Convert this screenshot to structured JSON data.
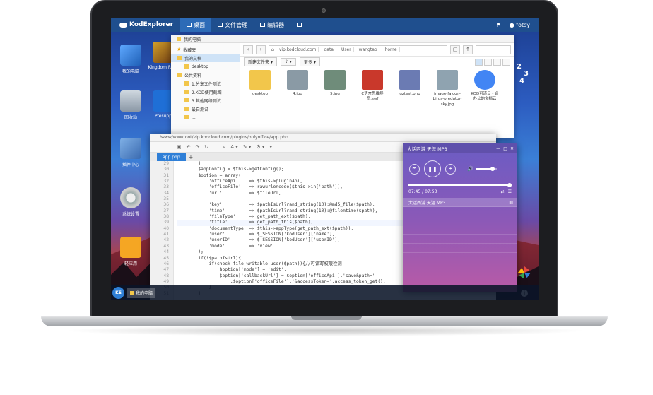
{
  "app": {
    "brand": "KodExplorer",
    "nav": [
      {
        "label": "桌面"
      },
      {
        "label": "文件管理"
      },
      {
        "label": "编辑器"
      }
    ],
    "user": "fotsy"
  },
  "desktop": {
    "icons": [
      {
        "label": "我的电脑"
      },
      {
        "label": "Kingdom Rush"
      },
      {
        "label": "回收站"
      },
      {
        "label": "Presupp"
      },
      {
        "label": "插件中心"
      },
      {
        "label": "系统设置"
      },
      {
        "label": "轻应用"
      }
    ],
    "clock_digits": [
      "2",
      "3",
      "4"
    ]
  },
  "taskbar": {
    "start_label": "KE",
    "items": [
      {
        "label": "我的电脑"
      }
    ]
  },
  "explorer": {
    "title": "我的电脑",
    "tree": [
      {
        "label": "收藏夹"
      },
      {
        "label": "我的文档"
      },
      {
        "label": "desktop"
      },
      {
        "label": "公共资料"
      },
      {
        "label": "1.分享文件测试"
      },
      {
        "label": "2.KOD使用截图"
      },
      {
        "label": "3.其他网络测试"
      },
      {
        "label": "最自测试"
      },
      {
        "label": "..."
      }
    ],
    "breadcrumbs": [
      "vip.kodcloud.com",
      "data",
      "User",
      "wangtao",
      "home"
    ],
    "new_folder": "新建文件夹",
    "more": "更多",
    "files": [
      {
        "name": "desktop",
        "color": "#f2c64b"
      },
      {
        "name": "4.jpg",
        "color": "#8a9aa5"
      },
      {
        "name": "5.jpg",
        "color": "#6f8c7a"
      },
      {
        "name": "C语言思维导图.swf",
        "color": "#c9382b"
      },
      {
        "name": "gztest.php",
        "color": "#6b7bb3"
      },
      {
        "name": "image-falcon-birds-predator-sky.jpg",
        "color": "#8fa3b0"
      },
      {
        "name": "KOD可道云 - 合办公的文档云",
        "color": "#4285f4"
      }
    ]
  },
  "editor": {
    "path": "/www/wwwroot/vip.kodcloud.com/plugins/onlyoffice/app.php",
    "tab": "app.php",
    "gutter": [
      "29",
      "30",
      "31",
      "32",
      "33",
      "34",
      "35",
      "36",
      "37",
      "38",
      "39",
      "40",
      "41",
      "42",
      "43",
      "44",
      "45",
      "46",
      "47",
      "48",
      "49",
      "50",
      "51"
    ],
    "code": [
      "        }",
      "        $appConfig = $this->getConfig();",
      "        $option = array(",
      "            'officeApi'    => $this->pluginApi,",
      "            'officeFile'   => rawurlencode($this->in['path']),",
      "            'url'          => $fileUrl,",
      "",
      "            'key'          => $pathIsUrl?rand_string(10):@md5_file($path),",
      "            'time'         => $pathIsUrl?rand_string(10):@filemtime($path),",
      "            'fileType'     => get_path_ext($path),",
      "            'title'        => get_path_this($path),",
      "            'documentType' => $this->appType(get_path_ext($path)),",
      "            'user'         => $_SESSION['kodUser']['name'],",
      "            'userID'       => $_SESSION['kodUser']['userID'],",
      "            'mode'         => 'view'",
      "        );",
      "        if(!$pathIsUrl){",
      "            if(check_file_writable_user($path)){//可读写权限检测",
      "                $option['mode'] = 'edit';",
      "                $option['callbackUrl'] = $option['officeApi'].'save&path='",
      "                    .$option['officeFile'].'&accessToken='.access_token_get();",
      "            }",
      "        }"
    ]
  },
  "music": {
    "title": "大话西游 天涯 MP3",
    "time": "07:45 / 07:53",
    "progress": 0.98,
    "volume": 0.8,
    "playlist": [
      "大话西游 天涯 MP3"
    ]
  },
  "colors": {
    "topbar": "#1f4f8e",
    "accent": "#2f7fd7",
    "player_top": "#6b5cc4",
    "player_bottom": "#b95aa6"
  }
}
